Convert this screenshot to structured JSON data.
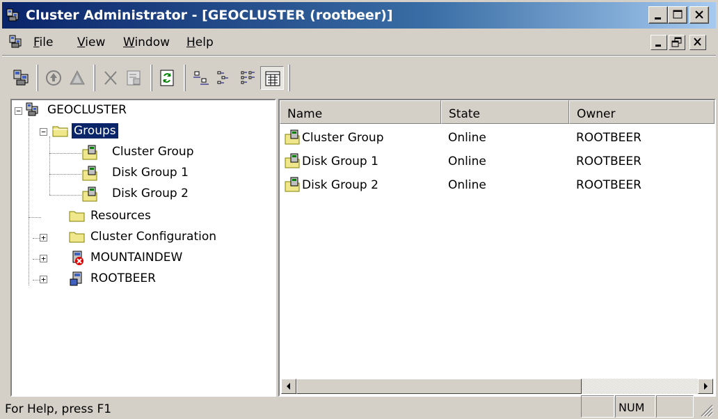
{
  "window": {
    "title": "Cluster Administrator - [GEOCLUSTER (rootbeer)]"
  },
  "menu": {
    "items": [
      {
        "label": "File",
        "mnemonic": "F"
      },
      {
        "label": "View",
        "mnemonic": "V"
      },
      {
        "label": "Window",
        "mnemonic": "W"
      },
      {
        "label": "Help",
        "mnemonic": "H"
      }
    ]
  },
  "toolbar": {
    "buttons": [
      "open-connection-icon",
      "bring-online-icon",
      "take-offline-icon",
      "delete-icon",
      "properties-icon",
      "refresh-icon",
      "large-icons-icon",
      "small-icons-icon",
      "list-view-icon",
      "details-view-icon"
    ]
  },
  "tree": {
    "root": "GEOCLUSTER",
    "groups": "Groups",
    "group_items": [
      "Cluster Group",
      "Disk Group 1",
      "Disk Group 2"
    ],
    "resources": "Resources",
    "cluster_config": "Cluster Configuration",
    "nodes": [
      "MOUNTAINDEW",
      "ROOTBEER"
    ]
  },
  "list": {
    "columns": [
      "Name",
      "State",
      "Owner"
    ],
    "rows": [
      {
        "name": "Cluster Group",
        "state": "Online",
        "owner": "ROOTBEER"
      },
      {
        "name": "Disk Group 1",
        "state": "Online",
        "owner": "ROOTBEER"
      },
      {
        "name": "Disk Group 2",
        "state": "Online",
        "owner": "ROOTBEER"
      }
    ]
  },
  "status": {
    "message": "For Help, press F1",
    "num": "NUM"
  },
  "colors": {
    "title_active": "#0a246a",
    "face": "#d4d0c8",
    "selection": "#0a246a"
  }
}
